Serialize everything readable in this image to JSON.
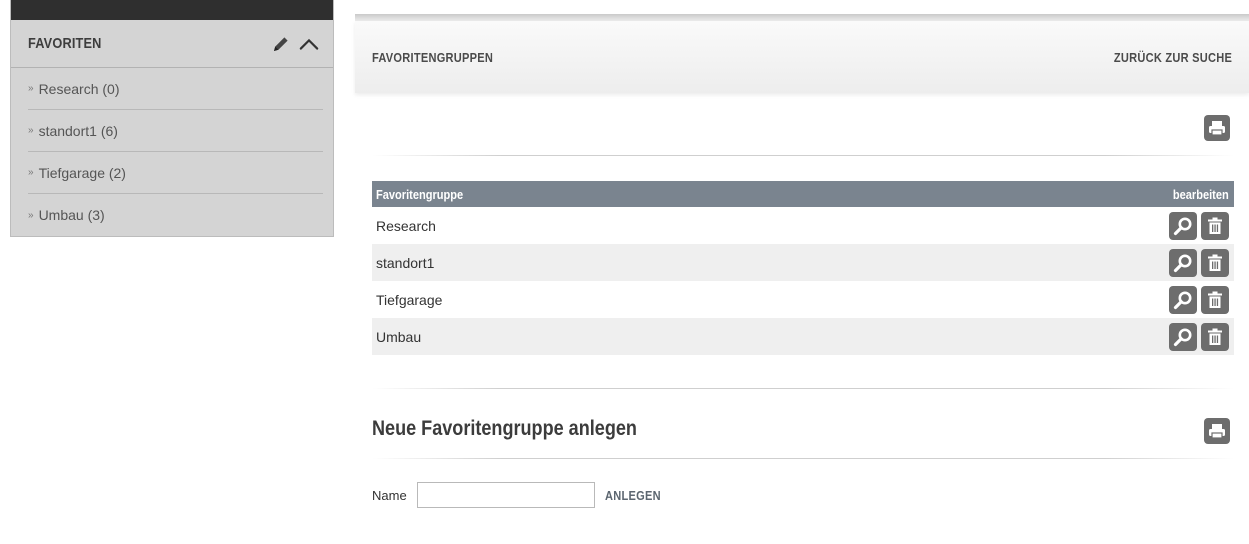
{
  "sidebar": {
    "title": "FAVORITEN",
    "items": [
      {
        "label": "Research (0)"
      },
      {
        "label": "standort1 (6)"
      },
      {
        "label": "Tiefgarage (2)"
      },
      {
        "label": "Umbau (3)"
      }
    ],
    "bullet": "»"
  },
  "header": {
    "title": "FAVORITENGRUPPEN",
    "back_link": "ZURÜCK ZUR SUCHE"
  },
  "table": {
    "col_group": "Favoritengruppe",
    "col_edit": "bearbeiten",
    "rows": [
      {
        "name": "Research"
      },
      {
        "name": "standort1"
      },
      {
        "name": "Tiefgarage"
      },
      {
        "name": "Umbau"
      }
    ]
  },
  "new_group": {
    "title": "Neue Favoritengruppe anlegen",
    "name_label": "Name",
    "name_value": "",
    "submit_label": "ANLEGEN"
  },
  "colors": {
    "sidebar_bg": "#d4d4d4",
    "table_header_bg": "#7a848f",
    "icon_button_bg": "#6d6d6d"
  },
  "icons": {
    "edit": "pencil-icon",
    "collapse": "chevron-up-icon",
    "print": "printer-icon",
    "search": "magnifier-icon",
    "delete": "trash-icon"
  }
}
